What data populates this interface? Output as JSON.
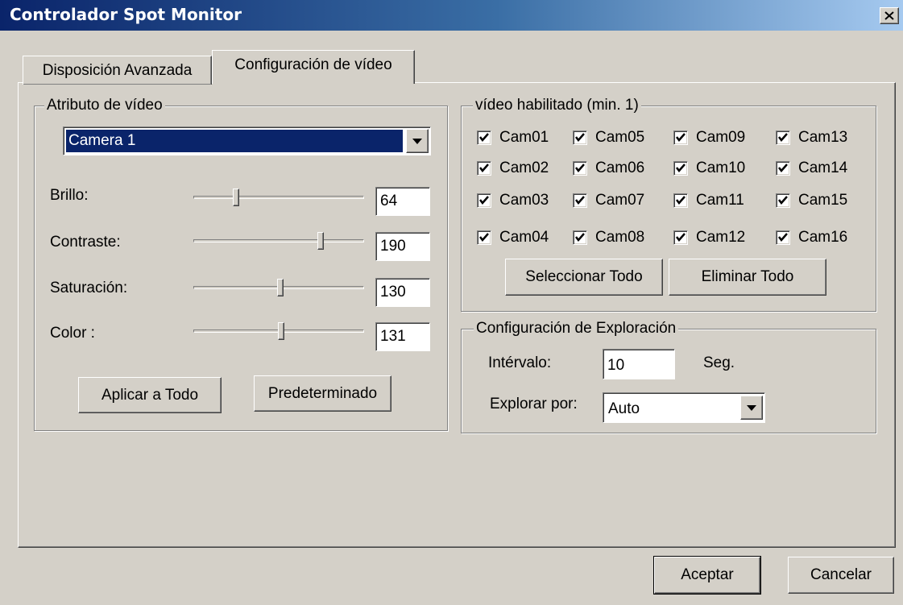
{
  "window": {
    "title": "Controlador Spot Monitor",
    "close_label": "x"
  },
  "tabs": [
    {
      "label": "Disposición Avanzada",
      "active": false
    },
    {
      "label": "Configuración de vídeo",
      "active": true
    }
  ],
  "video_attr": {
    "legend": "Atributo de vídeo",
    "camera_select": "Camera 1",
    "sliders": [
      {
        "label": "Brillo:",
        "value": "64",
        "level": 0.25
      },
      {
        "label": "Contraste:",
        "value": "190",
        "level": 0.745
      },
      {
        "label": "Saturación:",
        "value": "130",
        "level": 0.51
      },
      {
        "label": "Color :",
        "value": "131",
        "level": 0.514
      }
    ],
    "apply_all_label": "Aplicar a Todo",
    "default_label": "Predeterminado"
  },
  "video_enabled": {
    "legend": "vídeo habilitado (min. 1)",
    "cameras": [
      [
        "Cam01",
        "Cam05",
        "Cam09",
        "Cam13"
      ],
      [
        "Cam02",
        "Cam06",
        "Cam10",
        "Cam14"
      ],
      [
        "Cam03",
        "Cam07",
        "Cam11",
        "Cam15"
      ],
      [
        "Cam04",
        "Cam08",
        "Cam12",
        "Cam16"
      ]
    ],
    "checked": true,
    "select_all_label": "Seleccionar Todo",
    "remove_all_label": "Eliminar Todo"
  },
  "scan_config": {
    "legend": "Configuración de Exploración",
    "interval_label": "Intérvalo:",
    "interval_value": "10",
    "interval_unit": "Seg.",
    "scan_by_label": "Explorar por:",
    "scan_by_value": "Auto"
  },
  "footer": {
    "ok_label": "Aceptar",
    "cancel_label": "Cancelar"
  },
  "colors": {
    "face": "#d4d0c8",
    "title_start": "#0a246a",
    "selection": "#0a246a"
  }
}
